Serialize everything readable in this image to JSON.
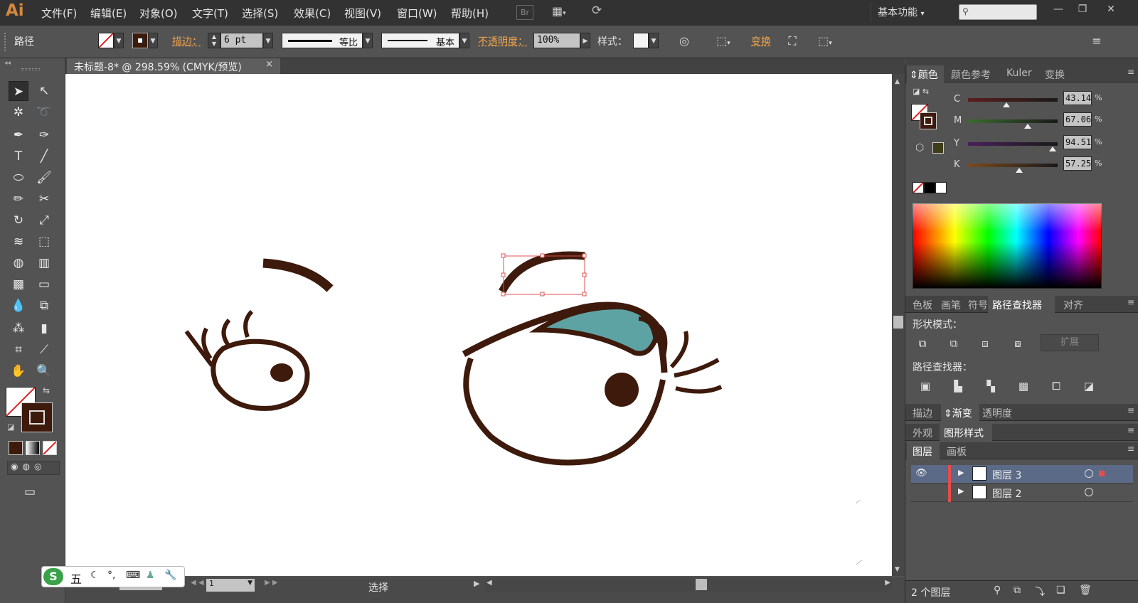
{
  "app": {
    "logo": "Ai"
  },
  "menu": [
    "文件(F)",
    "编辑(E)",
    "对象(O)",
    "文字(T)",
    "选择(S)",
    "效果(C)",
    "视图(V)",
    "窗口(W)",
    "帮助(H)"
  ],
  "menubar": {
    "bridge": "Br",
    "workspace": "基本功能",
    "workspace_arrow": "▾"
  },
  "controlbar": {
    "selection_type": "路径",
    "stroke_label": "描边：",
    "stroke_weight": "6 pt",
    "profile_uniform": "等比",
    "brush_basic": "基本",
    "opacity_label": "不透明度：",
    "opacity_value": "100%",
    "style_label": "样式：",
    "transform_label": "变换"
  },
  "document": {
    "tab_title": "未标题-8* @ 298.59% (CMYK/预览)",
    "close": "×"
  },
  "status": {
    "zoom": "298.59",
    "artboard": "1",
    "tool_name": "选择"
  },
  "ime": {
    "logo": "S",
    "mode": "五"
  },
  "color_panel": {
    "tabs": [
      "颜色",
      "颜色参考",
      "Kuler",
      "变换"
    ],
    "active_tab": "颜色",
    "channels": [
      {
        "name": "C",
        "value": "43.14",
        "level": 0.43,
        "color_from": "#5a1d1d",
        "color_to": "#1a1a1a"
      },
      {
        "name": "M",
        "value": "67.06",
        "level": 0.67,
        "color_from": "#3a6b2e",
        "color_to": "#1a1a1a"
      },
      {
        "name": "Y",
        "value": "94.51",
        "level": 0.945,
        "color_from": "#4a1f5a",
        "color_to": "#1a1a1a"
      },
      {
        "name": "K",
        "value": "57.25",
        "level": 0.57,
        "color_from": "#7a4a1f",
        "color_to": "#1a1a1a"
      }
    ],
    "percent": "%"
  },
  "swatches_panel": {
    "tabs": [
      "色板",
      "画笔",
      "符号",
      "路径查找器",
      "对齐"
    ],
    "active_tab": "路径查找器",
    "shape_modes_label": "形状模式：",
    "expand_label": "扩展",
    "pathfinders_label": "路径查找器："
  },
  "stroke_panel": {
    "tabs": [
      "描边",
      "渐变",
      "透明度"
    ],
    "active_tab": "渐变"
  },
  "appearance_panel": {
    "tabs": [
      "外观",
      "图形样式"
    ],
    "active_tab": "图形样式"
  },
  "layers_panel": {
    "tabs": [
      "图层",
      "画板"
    ],
    "active_tab": "图层",
    "layers": [
      {
        "name": "图层 3",
        "selected": true
      },
      {
        "name": "图层 2",
        "selected": false
      }
    ],
    "footer_count": "2 个图层"
  },
  "colors": {
    "stroke_brown": "#3d1a0c",
    "eyelid_teal": "#5ea3a3",
    "accent_orange": "#f0a24a",
    "selection_red": "#e05050"
  }
}
